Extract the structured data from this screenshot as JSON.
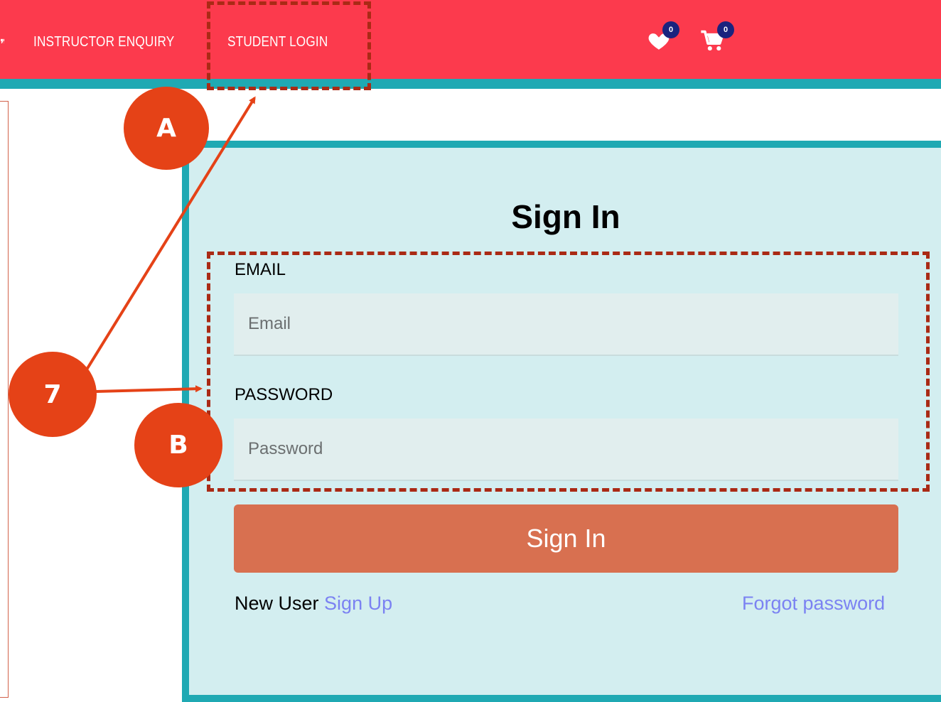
{
  "header": {
    "nav_items": [
      "INSTRUCTOR ENQUIRY",
      "STUDENT LOGIN"
    ],
    "wishlist_count": "0",
    "cart_count": "0"
  },
  "signin": {
    "title": "Sign In",
    "email_label": "EMAIL",
    "email_placeholder": "Email",
    "password_label": "PASSWORD",
    "password_placeholder": "Password",
    "submit_label": "Sign In",
    "new_user_text": "New User",
    "signup_link": "Sign Up",
    "forgot_link": "Forgot password"
  },
  "annotations": {
    "marker_a": "A",
    "marker_b": "B",
    "marker_7": "7"
  },
  "colors": {
    "header": "#fc3a4d",
    "teal": "#1fa9b3",
    "panel": "#d3eef0",
    "button": "#d87050",
    "link": "#7b82f2",
    "marker": "#e54217",
    "dash": "#aa2a15",
    "badge": "#1a237e"
  },
  "icons": [
    "heart-icon",
    "shopping-cart-icon"
  ]
}
